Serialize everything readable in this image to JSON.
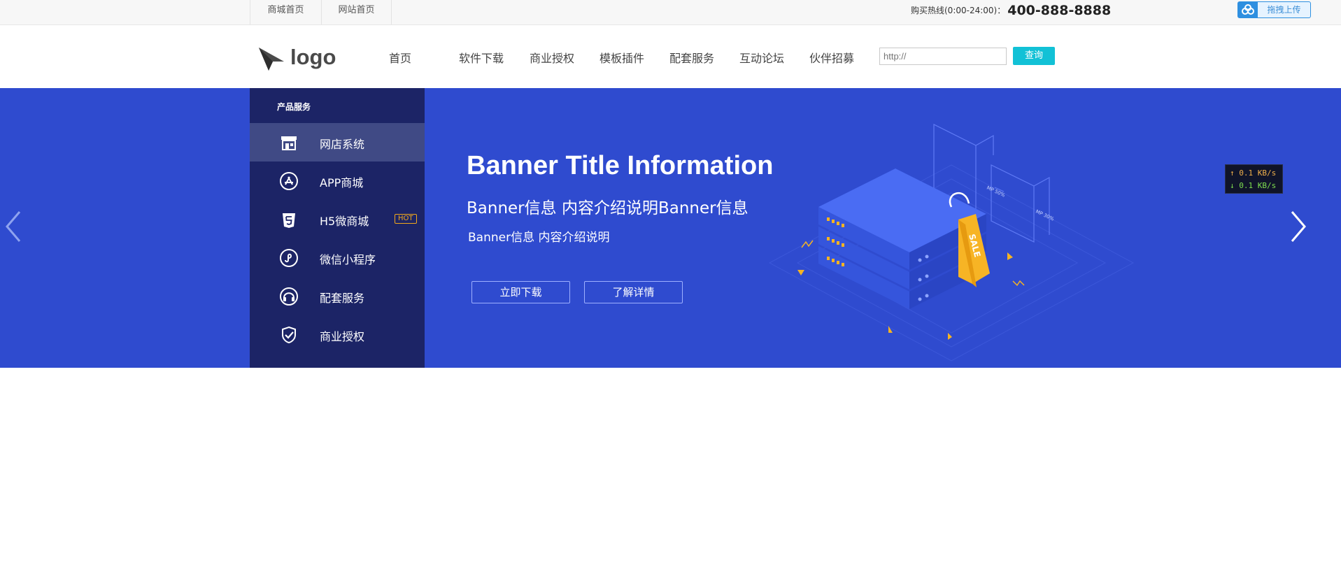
{
  "topbar": {
    "links": [
      "商城首页",
      "网站首页"
    ],
    "hotline_label": "购买热线(0:00-24:00)：",
    "hotline_number": "400-888-8888",
    "upload_label": "拖拽上传"
  },
  "header": {
    "logo_text": "logo",
    "nav": [
      "首页",
      "软件下载",
      "商业授权",
      "模板插件",
      "配套服务",
      "互动论坛",
      "伙伴招募"
    ],
    "search_placeholder": "http://",
    "search_button": "查询"
  },
  "sidebar": {
    "title": "产品服务",
    "items": [
      {
        "label": "网店系统",
        "icon": "store-icon"
      },
      {
        "label": "APP商城",
        "icon": "app-store-icon"
      },
      {
        "label": "H5微商城",
        "icon": "html5-icon",
        "badge": "HOT"
      },
      {
        "label": "微信小程序",
        "icon": "mini-program-icon"
      },
      {
        "label": "配套服务",
        "icon": "headset-icon"
      },
      {
        "label": "商业授权",
        "icon": "shield-check-icon"
      }
    ]
  },
  "banner": {
    "title": "Banner Title Information",
    "subtitle": "Banner信息 内容介绍说明Banner信息",
    "description": "Banner信息 内容介绍说明",
    "button_primary": "立即下载",
    "button_secondary": "了解详情",
    "illustration_tag": "SALE",
    "colors": {
      "background": "#2f4bcf",
      "sidebar": "#1c2466",
      "accent": "#12c1d6"
    }
  },
  "speed_widget": {
    "up": "↑ 0.1 KB/s",
    "down": "↓ 0.1 KB/s"
  }
}
